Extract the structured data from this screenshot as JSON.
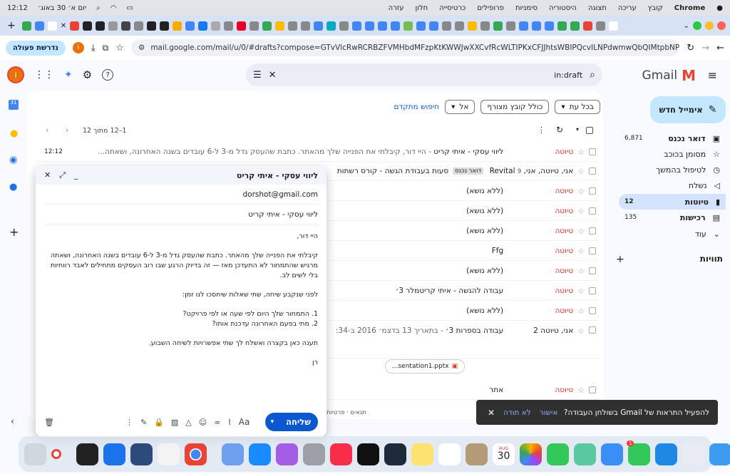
{
  "menubar": {
    "clock": "12:12",
    "date": "יום א׳ 30 באוג׳",
    "app": "Chrome",
    "menus": [
      "קובץ",
      "עריכה",
      "תצוגה",
      "היסטוריה",
      "סימניות",
      "פרופילים",
      "כרטיסייה",
      "חלון",
      "עזרה"
    ]
  },
  "browser": {
    "action_pill": "נדרשת פעולה",
    "profile_initial": "i",
    "url": "mail.google.com/mail/u/0/#drafts?compose=GTvVlcRwRCRBZFVMHbdMFzpKtKWWJwXXCvfRcWLTIPKxCFJJhtsWBIPQcvILNPdwmwQbQIMtpbNPC",
    "new_tab_label": "+"
  },
  "gmail": {
    "logo_text": "Gmail",
    "search_value": "in:draft",
    "avatar_initial": "i",
    "compose_label": "אימייל חדש",
    "nav": [
      {
        "label": "דואר נכנס",
        "count": "6,871",
        "bold": true,
        "icon": "inbox-icon"
      },
      {
        "label": "מסומן בכוכב",
        "count": "",
        "bold": false,
        "icon": "star-icon"
      },
      {
        "label": "לטיפול בהמשך",
        "count": "",
        "bold": false,
        "icon": "clock-icon"
      },
      {
        "label": "נשלח",
        "count": "",
        "bold": false,
        "icon": "send-icon"
      },
      {
        "label": "טיוטות",
        "count": "12",
        "bold": true,
        "icon": "draft-icon",
        "active": true
      },
      {
        "label": "רכישות",
        "count": "135",
        "bold": true,
        "icon": "purchases-icon"
      },
      {
        "label": "עוד",
        "count": "",
        "bold": false,
        "icon": "chevron-down-icon"
      }
    ],
    "labels_title": "תוויות",
    "labels_add": "+",
    "filters": {
      "any_time": "בכל עת",
      "has_attachment": "כולל קובץ מצורף",
      "to": "אל",
      "advanced": "חיפוש מתקדם"
    },
    "pagination": "1–12 מתוך 12",
    "emails": [
      {
        "sender": "טיוטה",
        "sender_draft": true,
        "subject": "ליווי עסקי - איתי קריט",
        "snippet": " - היי דור, קיבלתי את הפנייה שלך מהאתר. כתבת שהעסק גדל מ-3 ל-6 עובדים בשנה האחרונה, ושאתה...",
        "time": "12:12",
        "attachment": ""
      },
      {
        "sender": "אני, טיוטה, אני, Revital",
        "sender_draft": false,
        "count": "9",
        "label": "דואר נכנס",
        "subject": "סעות בעבודת הגשה - קורס רשתות",
        "snippet": "",
        "time": "",
        "attachment": ""
      },
      {
        "sender": "טיוטה",
        "sender_draft": true,
        "subject": "(ללא נושא)",
        "snippet": "",
        "time": "",
        "attachment": ""
      },
      {
        "sender": "טיוטה",
        "sender_draft": true,
        "subject": "(ללא נושא)",
        "snippet": "",
        "time": "",
        "attachment": ""
      },
      {
        "sender": "טיוטה",
        "sender_draft": true,
        "subject": "(ללא נושא)",
        "snippet": "",
        "time": "",
        "attachment": ""
      },
      {
        "sender": "טיוטה",
        "sender_draft": true,
        "subject": "Ffg",
        "snippet": "",
        "time": "",
        "attachment": ""
      },
      {
        "sender": "טיוטה",
        "sender_draft": true,
        "subject": "(ללא נושא)",
        "snippet": "",
        "time": "",
        "attachment": ""
      },
      {
        "sender": "טיוטה",
        "sender_draft": true,
        "subject": "עבודה להגשה - איתי קריטמלר 3׳",
        "snippet": "",
        "time": "",
        "attachment": ""
      },
      {
        "sender": "טיוטה",
        "sender_draft": true,
        "subject": "(ללא נושא)",
        "snippet": "",
        "time": "",
        "attachment": ""
      },
      {
        "sender": "אני, טיוטה 2",
        "sender_draft": false,
        "subject": "עבודה בספרות 3׳",
        "snippet": " - בתאריך 13 בדצמ׳ 2016 ב-34:",
        "time": "",
        "attachment": "...sentation1.pptx"
      },
      {
        "sender": "טיוטה",
        "sender_draft": true,
        "subject": "אתר",
        "snippet": "",
        "time": "",
        "attachment": ""
      }
    ],
    "footer_terms": "תנאים · פרטיות"
  },
  "compose": {
    "title": "ליווי עסקי - איתי קריט",
    "to": "dorshot@gmail.com",
    "subject": "ליווי עסקי - איתי קריט",
    "body": [
      "היי דור,",
      "קיבלתי את הפנייה שלך מהאתר. כתבת שהעסק גדל מ-3 ל-6 עובדים בשנה האחרונה, ושאתה מרגיש שהתמחור לא התעדכן מאז — זה בדיוק הרגע שבו רוב העסקים מתחילים לאבד רווחיות בלי לשים לב.",
      "לפני שנקבע שיחה, שתי שאלות שיחסכו לנו זמן:",
      "1. התמחור שלך היום לפי שעה או לפי פרויקט?\n2. מתי בפעם האחרונה עדכנת אותו?",
      "תענה כאן בקצרה ואשלח לך שתי אפשרויות לשיחה השבוע.",
      "רן"
    ],
    "send_label": "שליחה",
    "format_label": "Aa"
  },
  "snackbar": {
    "text": "להפעיל התראות של Gmail בשולחן העבודה?",
    "confirm": "אישור",
    "decline": "לא תודה"
  },
  "dock": {
    "calendar_day": "30",
    "calendar_month": "AUG",
    "messages_badge": "1"
  },
  "colors": {
    "accent": "#0b57d0",
    "compose_btn": "#c2e7ff",
    "draft_red": "#d93025",
    "active_nav": "#d3e3fd"
  }
}
